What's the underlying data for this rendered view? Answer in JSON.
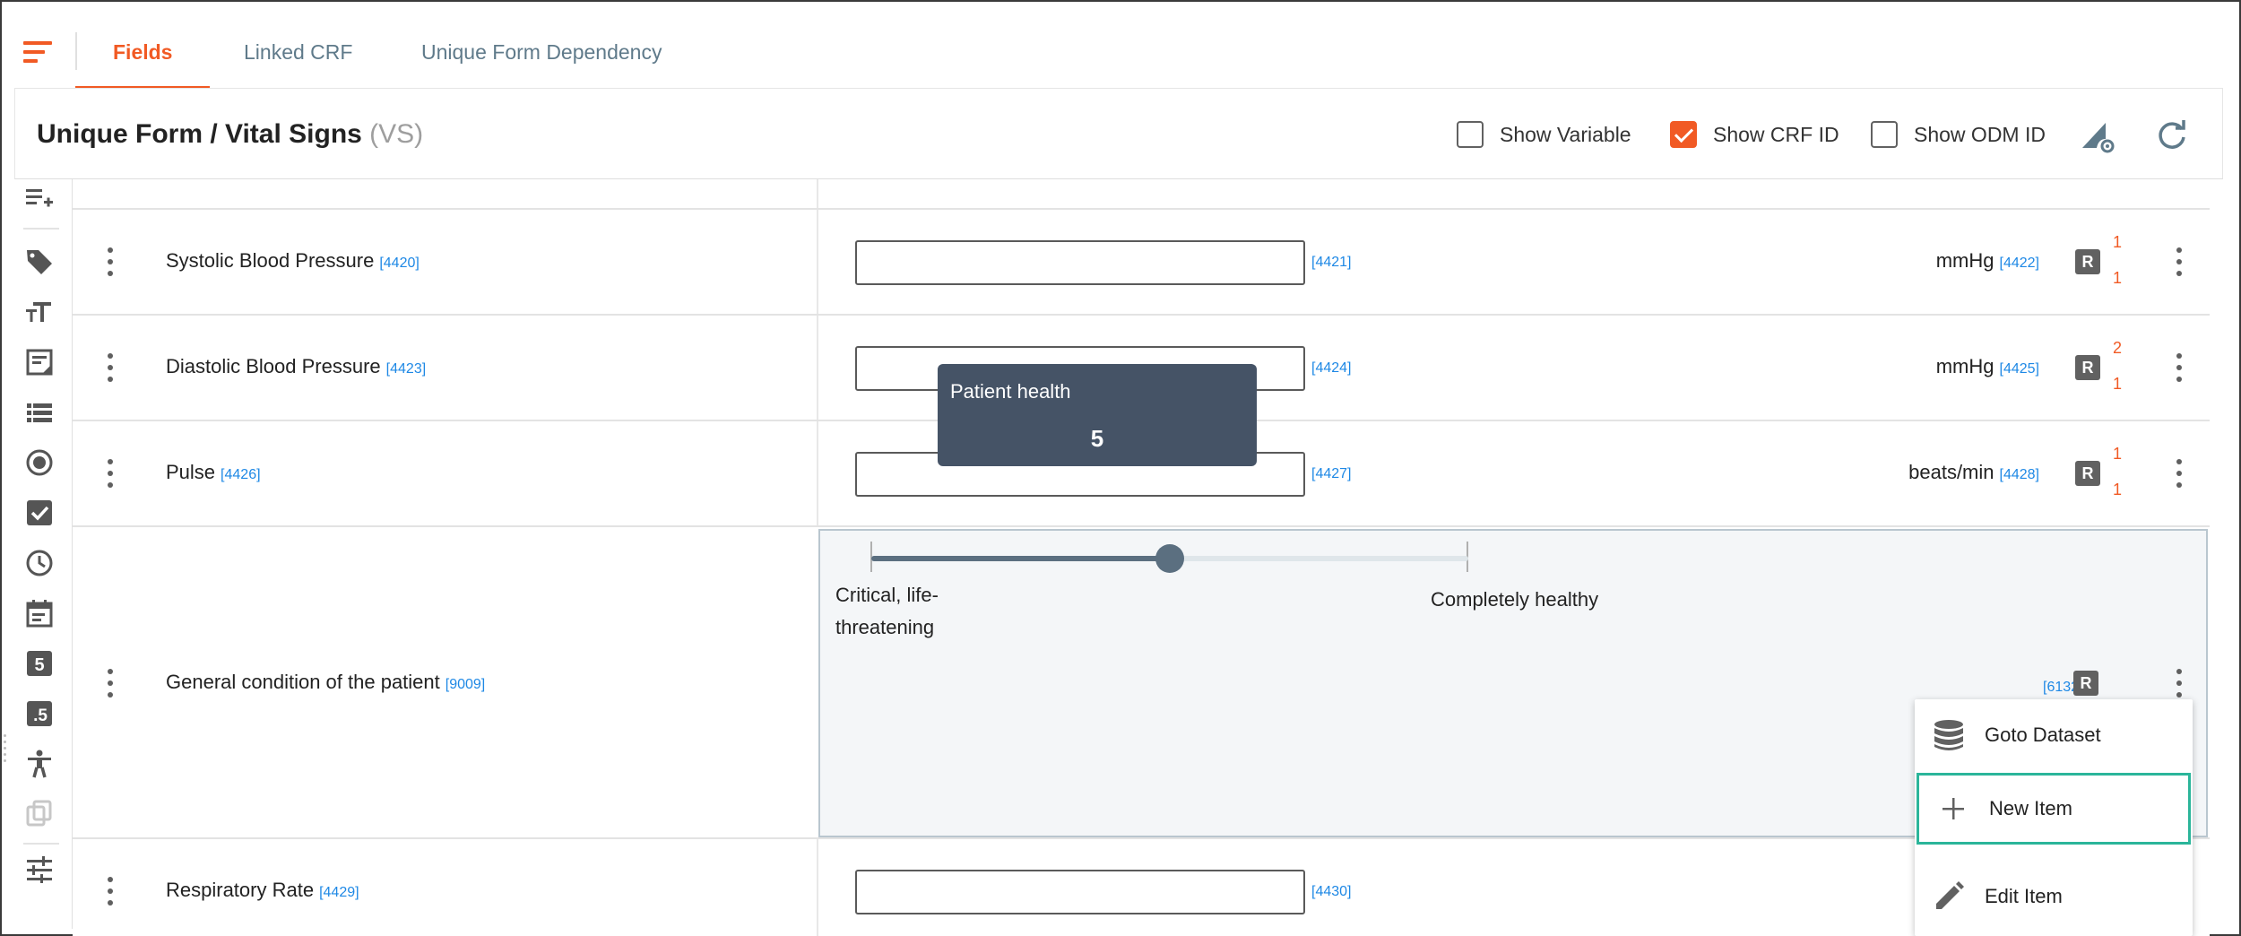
{
  "tabs": [
    {
      "label": "Fields",
      "active": true
    },
    {
      "label": "Linked CRF",
      "active": false
    },
    {
      "label": "Unique Form Dependency",
      "active": false
    }
  ],
  "form": {
    "title": "Unique Form / Vital Signs",
    "code": "(VS)"
  },
  "options": {
    "show_variable": {
      "label": "Show Variable",
      "checked": false
    },
    "show_crf_id": {
      "label": "Show CRF ID",
      "checked": true
    },
    "show_odm_id": {
      "label": "Show ODM ID",
      "checked": false
    }
  },
  "toolbar_icons": [
    "settings-triangle-icon",
    "refresh-icon"
  ],
  "tools": [
    "add-list-icon",
    "tag-icon",
    "text-size-icon",
    "note-icon",
    "list-icon",
    "radio-icon",
    "checkbox-icon",
    "clock-icon",
    "calendar-icon",
    "number-icon",
    "decimal-icon",
    "accessibility-icon",
    "copy-icon",
    "tune-icon"
  ],
  "rows": [
    {
      "label": "Systolic Blood Pressure",
      "id": "[4420]",
      "input_id": "[4421]",
      "unit": "mmHg",
      "unit_id": "[4422]",
      "badge": "R",
      "count_top": "1",
      "count_bottom": "1"
    },
    {
      "label": "Diastolic Blood Pressure",
      "id": "[4423]",
      "input_id": "[4424]",
      "unit": "mmHg",
      "unit_id": "[4425]",
      "badge": "R",
      "count_top": "2",
      "count_bottom": "1"
    },
    {
      "label": "Pulse",
      "id": "[4426]",
      "input_id": "[4427]",
      "unit": "beats/min",
      "unit_id": "[4428]",
      "badge": "R",
      "count_top": "1",
      "count_bottom": "1"
    }
  ],
  "slider_row": {
    "label": "General condition of the patient",
    "id": "[9009]",
    "tooltip_title": "Patient health",
    "value": "5",
    "fraction": 0.5,
    "min_label_line1": "Critical, life-",
    "min_label_line2": "threatening",
    "max_label": "Completely healthy",
    "field_id": "[6132]",
    "badge": "R"
  },
  "last_row": {
    "label": "Respiratory Rate",
    "id": "[4429]",
    "input_id": "[4430]"
  },
  "context_menu": [
    {
      "label": "Goto Dataset",
      "icon": "database-icon"
    },
    {
      "label": "New Item",
      "icon": "plus-icon",
      "highlighted": true
    },
    {
      "label": "Edit Item",
      "icon": "pencil-icon"
    }
  ],
  "colors": {
    "accent": "#f15a24",
    "link": "#1e88e5",
    "tooltip": "#455366",
    "highlight": "#2bb59a"
  }
}
